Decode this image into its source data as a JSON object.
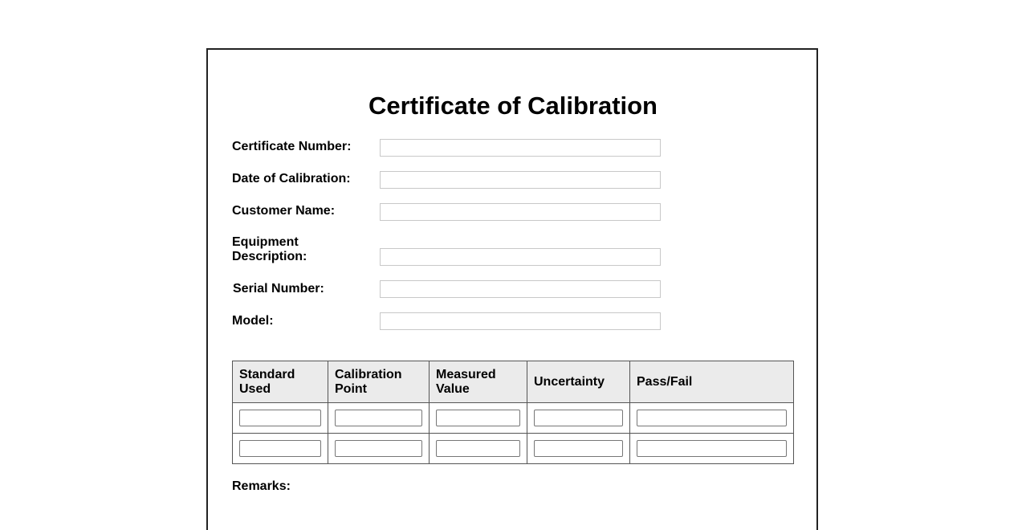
{
  "form": {
    "title": "Certificate of Calibration",
    "fields": [
      {
        "label": "Certificate Number:",
        "value": "",
        "placeholder": ""
      },
      {
        "label": "Date of Calibration:",
        "value": "",
        "placeholder": ""
      },
      {
        "label": "Customer Name:",
        "value": "",
        "placeholder": ""
      },
      {
        "label": "Equipment Description:",
        "value": "",
        "placeholder": ""
      },
      {
        "label": "Serial Number:",
        "value": "",
        "placeholder": ""
      },
      {
        "label": "Model:",
        "value": "",
        "placeholder": ""
      }
    ],
    "table": {
      "headers": [
        "Standard Used",
        "Calibration Point",
        "Measured Value",
        "Uncertainty",
        "Pass/Fail"
      ],
      "rows": [
        [
          "",
          "",
          "",
          "",
          ""
        ],
        [
          "",
          "",
          "",
          "",
          ""
        ]
      ]
    },
    "next_label": "Remarks:"
  }
}
